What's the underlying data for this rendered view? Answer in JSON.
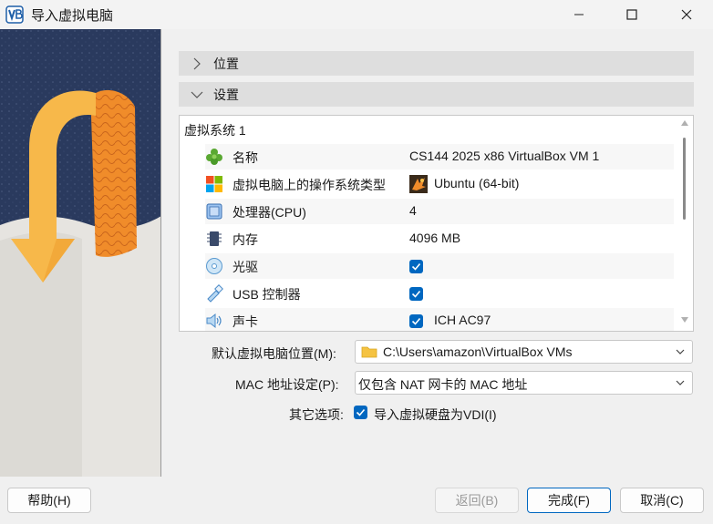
{
  "window": {
    "title": "导入虚拟电脑",
    "minimize_icon": "minimize-icon",
    "maximize_icon": "maximize-icon",
    "close_icon": "close-icon"
  },
  "sections": {
    "location_label": "位置",
    "settings_label": "设置"
  },
  "appliance": {
    "root_label": "虚拟系统 1",
    "rows": [
      {
        "icon": "name-icon",
        "key": "名称",
        "value": "CS144 2025 x86 VirtualBox VM 1",
        "type": "text"
      },
      {
        "icon": "os-type-icon",
        "key": "虚拟电脑上的操作系统类型",
        "value": "Ubuntu (64-bit)",
        "type": "os"
      },
      {
        "icon": "cpu-icon",
        "key": "处理器(CPU)",
        "value": "4",
        "type": "text"
      },
      {
        "icon": "memory-icon",
        "key": "内存",
        "value": "4096 MB",
        "type": "text"
      },
      {
        "icon": "optical-drive-icon",
        "key": "光驱",
        "value": "",
        "type": "checkbox",
        "checked": true
      },
      {
        "icon": "usb-icon",
        "key": "USB 控制器",
        "value": "",
        "type": "checkbox",
        "checked": true
      },
      {
        "icon": "audio-icon",
        "key": "声卡",
        "value": "ICH AC97",
        "type": "checkbox",
        "checked": true
      }
    ]
  },
  "form": {
    "location_label": "默认虚拟电脑位置(M):",
    "location_value": "C:\\Users\\amazon\\VirtualBox VMs",
    "mac_label": "MAC 地址设定(P):",
    "mac_value": "仅包含 NAT 网卡的 MAC 地址",
    "other_label": "其它选项:",
    "import_vdi_label": "导入虚拟硬盘为VDI(I)",
    "import_vdi_checked": true
  },
  "buttons": {
    "help": "帮助(H)",
    "back": "返回(B)",
    "finish": "完成(F)",
    "cancel": "取消(C)"
  },
  "colors": {
    "accent": "#0067c0",
    "section_bar": "#dedede"
  }
}
